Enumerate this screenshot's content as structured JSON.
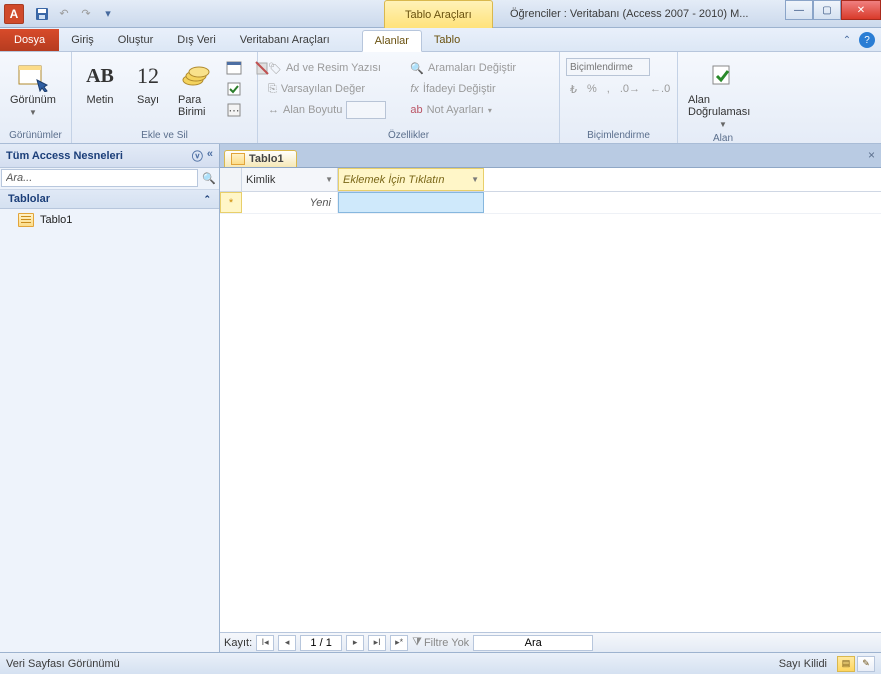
{
  "titlebar": {
    "app_letter": "A",
    "title": "Öğrenciler : Veritabanı (Access 2007 - 2010) M...",
    "context_tab_title": "Tablo Araçları"
  },
  "tabs": {
    "file": "Dosya",
    "items": [
      "Giriş",
      "Oluştur",
      "Dış Veri",
      "Veritabanı Araçları"
    ],
    "context": [
      "Alanlar",
      "Tablo"
    ],
    "active": "Alanlar"
  },
  "ribbon": {
    "group_views": {
      "label": "Görünümler",
      "view_btn": "Görünüm"
    },
    "group_addremove": {
      "label": "Ekle ve Sil",
      "text_btn": "Metin",
      "number_btn": "Sayı",
      "currency_btn": "Para Birimi"
    },
    "group_properties": {
      "label": "Özellikler",
      "name_caption": "Ad ve Resim Yazısı",
      "default_value": "Varsayılan Değer",
      "field_size": "Alan Boyutu",
      "modify_lookups": "Aramaları Değiştir",
      "modify_expression": "İfadeyi Değiştir",
      "memo_settings": "Not Ayarları"
    },
    "group_formatting": {
      "label": "Biçimlendirme",
      "placeholder": "Biçimlendirme"
    },
    "group_validation": {
      "label": "Alan Doğrulaması",
      "btn": "Alan Doğrulaması"
    }
  },
  "navpane": {
    "header": "Tüm Access Nesneleri",
    "search_value": "Ara...",
    "group": "Tablolar",
    "items": [
      "Tablo1"
    ]
  },
  "document": {
    "tab": "Tablo1",
    "col_id": "Kimlik",
    "col_add": "Eklemek İçin Tıklatın",
    "new_row_label": "Yeni"
  },
  "recnav": {
    "label": "Kayıt:",
    "position": "1 / 1",
    "filter": "Filtre Yok",
    "search": "Ara"
  },
  "statusbar": {
    "left": "Veri Sayfası Görünümü",
    "right": "Sayı Kilidi"
  }
}
